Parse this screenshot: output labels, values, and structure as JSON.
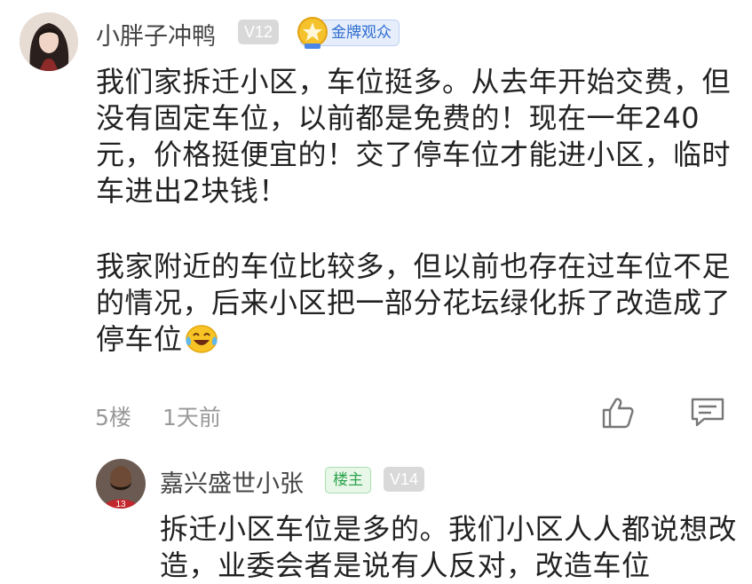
{
  "comments": [
    {
      "username": "小胖子冲鸭",
      "level": "V12",
      "fan_badge": "金牌观众",
      "paragraphs": [
        "我们家拆迁小区，车位挺多。从去年开始交费，但没有固定车位，以前都是免费的！现在一年240元，价格挺便宜的！交了停车位才能进小区，临时车进出2块钱！",
        "我家附近的车位比较多，但以前也存在过车位不足的情况，后来小区把一部分花坛绿化拆了改造成了停车位"
      ],
      "emoji": "laughing-tears-emoji",
      "floor": "5楼",
      "time": "1天前"
    },
    {
      "username": "嘉兴盛世小张",
      "host_badge": "楼主",
      "level": "V14",
      "text": "拆迁小区车位是多的。我们小区人人都说想改造，业委会者是说有人反对，改造车位"
    }
  ]
}
